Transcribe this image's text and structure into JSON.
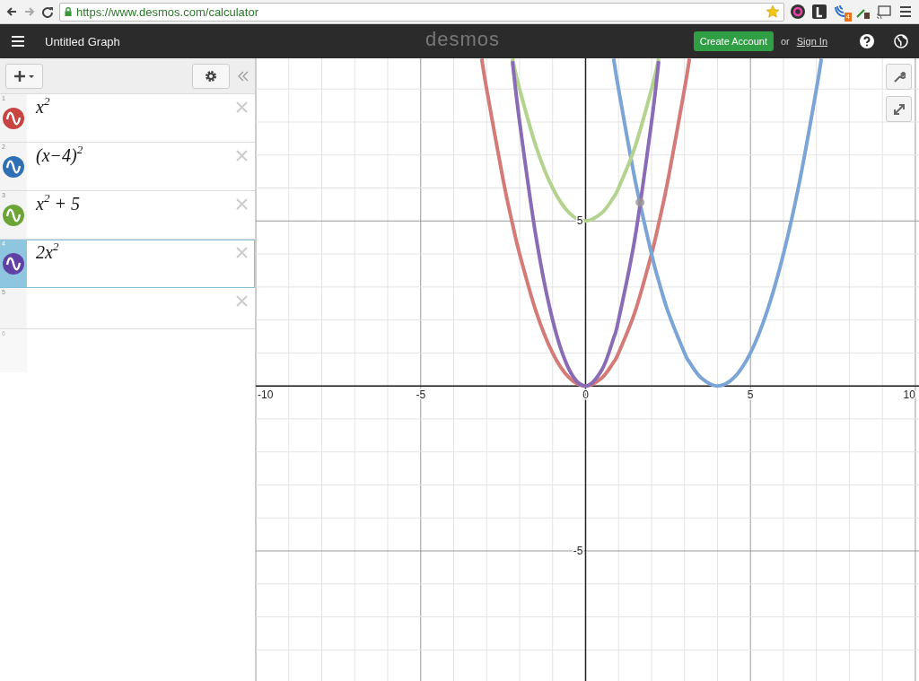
{
  "browser": {
    "url": "https://www.desmos.com/calculator",
    "extension_badge": "4"
  },
  "header": {
    "title": "Untitled Graph",
    "logo": "desmos",
    "create_account": "Create Account",
    "or": "or",
    "sign_in": "Sign In"
  },
  "expressions": [
    {
      "number": "1",
      "latex": "x$^{2}$",
      "color": "#c74440",
      "selected": false
    },
    {
      "number": "2",
      "latex": "(x−4)$^{2}$",
      "color": "#2d70b3",
      "selected": false
    },
    {
      "number": "3",
      "latex": "x$^{2}$ + 5",
      "color": "#6ca536",
      "selected": false
    },
    {
      "number": "4",
      "latex": "2x$^{2}$",
      "color": "#6042a6",
      "selected": true
    },
    {
      "number": "5",
      "selected": false
    },
    {
      "number": "6",
      "selected": false,
      "kind": "placeholder"
    }
  ],
  "graph": {
    "chart_data": {
      "type": "line",
      "grid": true,
      "xlim": [
        -10,
        10.11
      ],
      "ylim": [
        -8.97,
        9.93
      ],
      "xticks": [
        -10,
        -5,
        0,
        5,
        10
      ],
      "yticks": [
        -5,
        5
      ],
      "x": [
        -3.15,
        -3,
        -2.5,
        -2.218,
        -2,
        -1.5,
        -1,
        -0.5,
        0,
        0.5,
        0.85,
        1,
        1.5,
        2,
        2.218,
        2.5,
        3,
        3.15,
        3.5,
        4,
        4.5,
        5,
        5.5,
        6,
        6.5,
        7,
        7.15
      ],
      "series": [
        {
          "color": "#d47b78",
          "values": [
            9.92,
            9,
            6.25,
            4.92,
            4,
            2.25,
            1,
            0.25,
            0,
            0.25,
            0.72,
            1,
            2.25,
            4,
            4.92,
            6.25,
            9,
            9.92,
            null,
            null,
            null,
            null,
            null,
            null,
            null,
            null,
            null
          ]
        },
        {
          "color": "#7aa5d6",
          "values": [
            null,
            null,
            null,
            null,
            null,
            null,
            null,
            null,
            null,
            null,
            9.92,
            9,
            6.25,
            4,
            3.18,
            2.25,
            1,
            0.72,
            0.25,
            0,
            0.25,
            1,
            2.25,
            4,
            6.25,
            9,
            9.92
          ]
        },
        {
          "color": "#b3d38f",
          "values": [
            null,
            null,
            null,
            9.92,
            9,
            7.25,
            6,
            5.25,
            5,
            5.25,
            5.72,
            6,
            7.25,
            9,
            9.92,
            null,
            null,
            null,
            null,
            null,
            null,
            null,
            null,
            null,
            null,
            null,
            null
          ]
        },
        {
          "color": "#8a6cb6",
          "values": [
            null,
            null,
            null,
            9.84,
            8,
            4.5,
            2,
            0.5,
            0,
            0.5,
            1.45,
            2,
            4.5,
            8,
            9.84,
            null,
            null,
            null,
            null,
            null,
            null,
            null,
            null,
            null,
            null,
            null,
            null
          ]
        }
      ]
    }
  }
}
